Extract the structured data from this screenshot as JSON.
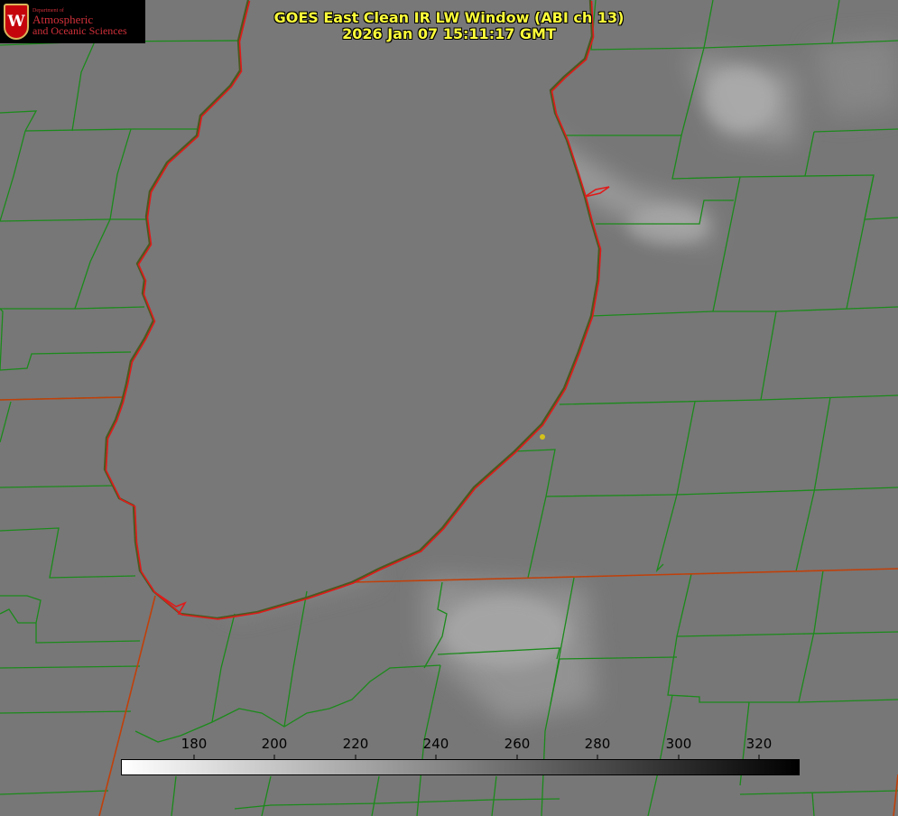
{
  "logo": {
    "department": "Department of",
    "line1": "Atmospheric",
    "line2": "and Oceanic Sciences",
    "crest_letter": "W"
  },
  "title": {
    "line1": "GOES East Clean IR LW Window (ABI ch 13)",
    "line2": "2026 Jan 07 15:11:17 GMT"
  },
  "colorbar": {
    "ticks": [
      "180",
      "200",
      "220",
      "240",
      "260",
      "280",
      "300",
      "320"
    ],
    "gradient": [
      "#ffffff",
      "#000000"
    ]
  },
  "colors": {
    "county_lines": "#1b8a1b",
    "state_lines": "#c0400a",
    "coastline": "#e01a1a",
    "title_text": "#ffff3a",
    "marker": "#d4c21a",
    "background": "#7a7a7a"
  }
}
